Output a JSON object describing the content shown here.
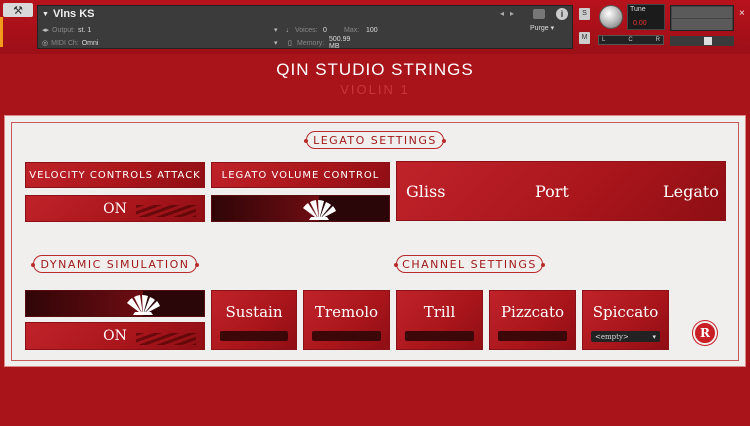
{
  "header": {
    "instrument_name": "Vlns KS",
    "output_label": "Output:",
    "output_value": "st. 1",
    "voices_label": "Voices:",
    "voices_value": "0",
    "max_label": "Max:",
    "max_value": "100",
    "purge_label": "Purge",
    "midi_label": "MIDI Ch:",
    "midi_value": "Omni",
    "memory_label": "Memory:",
    "memory_value": "500.99 MB",
    "solo_label": "S",
    "mute_label": "M",
    "tune_label": "Tune",
    "tune_value": "0.00",
    "pan_left": "L",
    "pan_center": "C",
    "pan_right": "R",
    "close_symbol": "×"
  },
  "title": "QIN STUDIO STRINGS",
  "subtitle": "VIOLIN 1",
  "legato_section": {
    "heading": "LEGATO SETTINGS",
    "velocity_attack_label": "VELOCITY CONTROLS ATTACK",
    "velocity_attack_state": "ON",
    "legato_volume_label": "LEGATO VOLUME CONTROL",
    "legato_volume_level": 0.6,
    "modes": [
      "Gliss",
      "Port",
      "Legato"
    ]
  },
  "dynamic_section": {
    "heading": "DYNAMIC SIMULATION",
    "level": 0.65,
    "state": "ON"
  },
  "channel_section": {
    "heading": "CHANNEL SETTINGS",
    "channels": [
      "Sustain",
      "Tremolo",
      "Trill",
      "Pizzcato",
      "Spiccato"
    ],
    "spiccato_dropdown": "<empty>"
  },
  "logo_letter": "R",
  "colors": {
    "brand_red": "#a8141a",
    "panel_bg": "#f1eeee",
    "accent_red": "#b72b2b"
  }
}
